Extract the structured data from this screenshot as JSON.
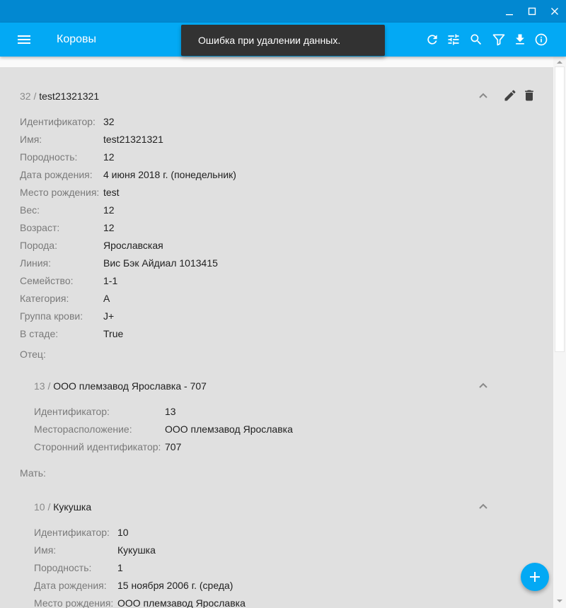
{
  "app": {
    "title": "Коровы"
  },
  "snackbar": {
    "message": "Ошибка при удалении данных."
  },
  "cow": {
    "header_id": "32 /",
    "header_name": "test21321321",
    "fields": [
      {
        "label": "Идентификатор:",
        "value": "32"
      },
      {
        "label": "Имя:",
        "value": "test21321321"
      },
      {
        "label": "Породность:",
        "value": "12"
      },
      {
        "label": "Дата рождения:",
        "value": "4 июня 2018 г. (понедельник)"
      },
      {
        "label": "Место рождения:",
        "value": "test"
      },
      {
        "label": "Вес:",
        "value": "12"
      },
      {
        "label": "Возраст:",
        "value": "12"
      },
      {
        "label": "Порода:",
        "value": "Ярославская"
      },
      {
        "label": "Линия:",
        "value": "Вис Бэк Айдиал 1013415"
      },
      {
        "label": "Семейство:",
        "value": "1-1"
      },
      {
        "label": "Категория:",
        "value": "A"
      },
      {
        "label": "Группа крови:",
        "value": "J+"
      },
      {
        "label": "В стаде:",
        "value": "True"
      }
    ]
  },
  "father": {
    "section_label": "Отец:",
    "header_id": "13 /",
    "header_name": "ООО племзавод Ярославка - 707",
    "fields": [
      {
        "label": "Идентификатор:",
        "value": "13"
      },
      {
        "label": "Месторасположение:",
        "value": "ООО племзавод Ярославка"
      },
      {
        "label": "Сторонний идентификатор:",
        "value": "707"
      }
    ]
  },
  "mother": {
    "section_label": "Мать:",
    "header_id": "10 /",
    "header_name": "Кукушка",
    "fields": [
      {
        "label": "Идентификатор:",
        "value": "10"
      },
      {
        "label": "Имя:",
        "value": "Кукушка"
      },
      {
        "label": "Породность:",
        "value": "1"
      },
      {
        "label": "Дата рождения:",
        "value": "15 ноября 2006 г. (среда)"
      },
      {
        "label": "Место рождения:",
        "value": "ООО племзавод Ярославка"
      }
    ]
  },
  "icons": {
    "menu": "menu-icon",
    "refresh": "refresh-icon",
    "tune": "tune-icon",
    "search": "search-icon",
    "filter": "filter-icon",
    "download": "download-icon",
    "info": "info-icon",
    "edit": "edit-icon",
    "delete": "delete-icon",
    "collapse": "chevron-up-icon",
    "add": "add-icon"
  },
  "colors": {
    "primary": "#03a9f4",
    "primary_dark": "#0288d1",
    "snackbar": "#323232",
    "background": "#e0e0e0"
  }
}
